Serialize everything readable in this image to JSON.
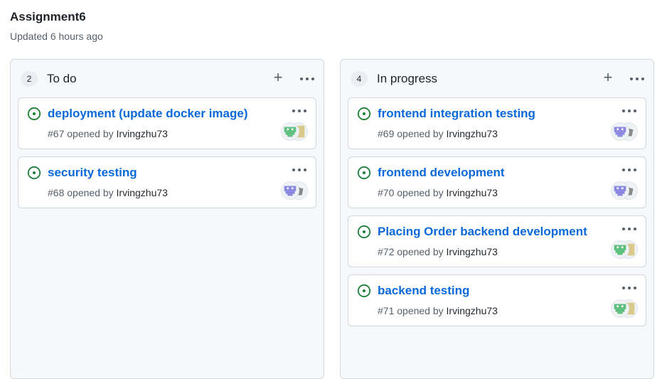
{
  "project": {
    "title": "Assignment6",
    "updated": "Updated 6 hours ago"
  },
  "columns": [
    {
      "count": "2",
      "name": "To do",
      "cards": [
        {
          "title": "deployment (update docker image)",
          "number": "#67",
          "opened_by": "opened by",
          "user": "Irvingzhu73",
          "avatar_colors": [
            "#5dbf7e",
            "#d9c98a"
          ]
        },
        {
          "title": "security testing",
          "number": "#68",
          "opened_by": "opened by",
          "user": "Irvingzhu73",
          "avatar_colors": [
            "#8b86e0",
            "#8a8a8a"
          ]
        }
      ]
    },
    {
      "count": "4",
      "name": "In progress",
      "cards": [
        {
          "title": "frontend integration testing",
          "number": "#69",
          "opened_by": "opened by",
          "user": "Irvingzhu73",
          "avatar_colors": [
            "#8b86e0",
            "#8a8a8a"
          ]
        },
        {
          "title": "frontend development",
          "number": "#70",
          "opened_by": "opened by",
          "user": "Irvingzhu73",
          "avatar_colors": [
            "#8b86e0",
            "#8a8a8a"
          ]
        },
        {
          "title": "Placing Order backend development",
          "number": "#72",
          "opened_by": "opened by",
          "user": "Irvingzhu73",
          "avatar_colors": [
            "#5dbf7e",
            "#d9c98a"
          ]
        },
        {
          "title": "backend testing",
          "number": "#71",
          "opened_by": "opened by",
          "user": "Irvingzhu73",
          "avatar_colors": [
            "#5dbf7e",
            "#d9c98a"
          ]
        }
      ]
    }
  ],
  "colors": {
    "open_issue": "#1a7f37",
    "link": "#0969da"
  },
  "icons": {
    "issue": "issue-opened-icon",
    "add": "plus-icon",
    "menu": "kebab-horizontal-icon"
  }
}
